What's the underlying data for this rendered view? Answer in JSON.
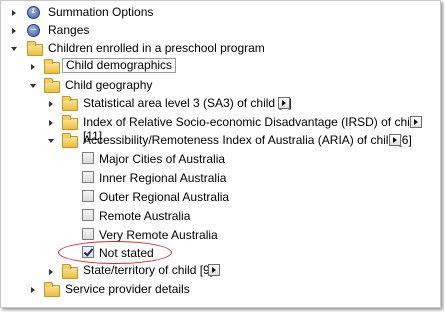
{
  "tree": {
    "summation_options": "Summation Options",
    "ranges": "Ranges",
    "children_enrolled": "Children enrolled in a preschool program",
    "child_demographics": "Child demographics",
    "child_geography": "Child geography",
    "sa3": "Statistical area level 3 (SA3) of child [1]",
    "irsd": "Index of Relative Socio-economic Disadvantage (IRSD) of child [11]",
    "aria": "Accessibility/Remoteness Index of Australia (ARIA) of child [6]",
    "aria_items": [
      {
        "label": "Major Cities of Australia",
        "checked": false
      },
      {
        "label": "Inner Regional Australia",
        "checked": false
      },
      {
        "label": "Outer Regional Australia",
        "checked": false
      },
      {
        "label": "Remote Australia",
        "checked": false
      },
      {
        "label": "Very Remote Australia",
        "checked": false
      },
      {
        "label": "Not stated",
        "checked": true
      }
    ],
    "state_territory": "State/territory of child [9]",
    "service_provider": "Service provider details"
  },
  "colors": {
    "highlight_ellipse": "#d0282d",
    "folder": "#e9bd3d"
  }
}
